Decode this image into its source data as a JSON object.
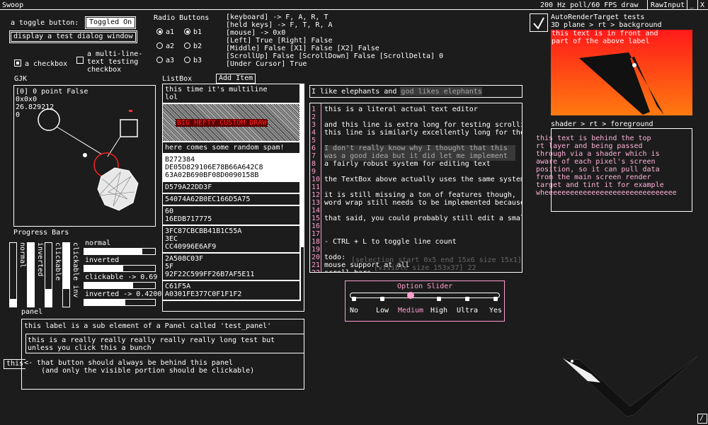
{
  "titlebar": {
    "title": "Swoop",
    "status": "200 Hz poll/60 FPS draw",
    "raw_input": "RawInput",
    "minimize": "_",
    "close": "X"
  },
  "toggle": {
    "label": "a toggle button:",
    "button": "Toggled On"
  },
  "dialog_button": "display a test dialog window",
  "checkbox": {
    "label": "a checkbox",
    "checked": true
  },
  "multiline_checkbox": {
    "label": "a multi-line-\ntext testing\ncheckbox",
    "checked": false
  },
  "radio": {
    "title": "Radio Buttons",
    "col_a": [
      {
        "label": "a1",
        "selected": true
      },
      {
        "label": "a2",
        "selected": false
      },
      {
        "label": "a3",
        "selected": false
      }
    ],
    "col_b": [
      {
        "label": "b1",
        "selected": true
      },
      {
        "label": "b2",
        "selected": false
      },
      {
        "label": "b3",
        "selected": false
      }
    ]
  },
  "input_state": [
    "[keyboard] -> F, A, R, T",
    "[held keys] -> F, T, R, A",
    "[mouse] -> 0x0",
    "[Left] True [Right] False",
    "[Middle] False [X1] False [X2] False",
    "[ScrollUp] False [ScrollDown] False [ScrollDelta] 0",
    "[Under Cursor] True"
  ],
  "gjk": {
    "title": "GJK",
    "lines": [
      "[0] 0 point False",
      "0x0x0",
      "26.829212",
      "0"
    ]
  },
  "listbox": {
    "title": "ListBox",
    "add_button": "Add Item",
    "items": [
      "this time it's multiline\nlol",
      "BIG HEFTY CUSTOM DRAW",
      "here comes some random spam!",
      "B272384\nDE05D829106E78B66A642C8\n63A02B690BF08D0090158B",
      "D579A22DD3F",
      "54074A62B0EC166D5A75",
      "60\n16EDB717775",
      "3FC87CBCBB41B1C55A\n3EC\nCC40996E6AF9",
      "2A508C03F\n5F\n92F22C599FF26B7AF5E11",
      "C61F5A\nA0301FE377C0F1F1F2"
    ]
  },
  "textbox": {
    "value": "I like elephants and god likes elephants"
  },
  "editor": {
    "lines": [
      "this is a literal actual text editor",
      "",
      "and this line is extra long for testing scrolli",
      "this line is similarly excellently long for the",
      "",
      "I don't really know why I thought that this",
      "was a good idea but it did let me implement",
      "a fairly robust system for editing text",
      "",
      "the TextBox above actually uses the same system",
      "",
      "it is still missing a ton of features though,",
      "word wrap still needs to be implemented because",
      "",
      "that said, you could probably still edit a smal",
      "",
      "",
      "- CTRL + L to toggle line count",
      "",
      "todo:",
      "mouse support at all",
      "scroll bars"
    ],
    "overlay_1": "[selection start 0x5 end 15x6 size 15x1]",
    "overlay_2": "[visible size 153x37] 22"
  },
  "progress": {
    "title": "Progress Bars",
    "vertical": [
      {
        "label": "normal",
        "value": 0.12
      },
      {
        "label": "inverted",
        "value": 1.0
      },
      {
        "label": "clickable",
        "value": 0.28
      },
      {
        "label": "clickable inv",
        "value": 0.72
      }
    ],
    "horizontal": [
      {
        "label": "normal",
        "value": 0.82
      },
      {
        "label": "inverted",
        "value": 0.55
      },
      {
        "label": "clickable -> 0.69",
        "value": 0.69
      },
      {
        "label": "inverted -> 0.4200",
        "value": 0.58
      }
    ]
  },
  "slider": {
    "title": "Option Slider",
    "options": [
      "No",
      "Low",
      "Medium",
      "High",
      "Ultra",
      "Yes"
    ],
    "selected_index": 2
  },
  "autorender": {
    "title": "AutoRenderTarget tests",
    "subtitle": "3D plane > rt > background",
    "front_label": "this text is in front and\npart of the above label",
    "checked": true
  },
  "shader": {
    "title": "shader > rt > foreground",
    "text": "this text is behind the top\nrt layer and being passed\nthrough via a shader which is\naware of each pixel's screen\nposition, so it can pull data\nfrom the main screen render\ntarget and tint it for example\nwheeeeeeeeeeeeeeeeeeeeeeeeeeeeeee"
  },
  "panel": {
    "title": "panel",
    "sub_label": "this label is a sub element of a Panel called 'test_panel'",
    "long_text": "this is a really really really really really long test but\nunless you click this a bunch",
    "behind_button": "this",
    "note": "<- that button should always be behind this panel\n    (and only the visible portion should be clickable)"
  },
  "corner_button": "/",
  "colors": {
    "accent": "#ff9fd0",
    "background": "#1c1c1c",
    "gradient_top": "#ff1a1a",
    "gradient_bottom": "#ff7a10"
  }
}
